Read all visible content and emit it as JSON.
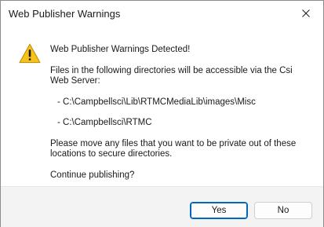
{
  "window": {
    "title": "Web Publisher Warnings",
    "close_icon": "close-icon"
  },
  "dialog": {
    "icon": "warning-triangle-icon",
    "heading": "Web Publisher Warnings Detected!",
    "files_line1": "Files in the following directories will be accessible via the Csi",
    "files_line2": "Web Server:",
    "directories": [
      "- C:\\Campbellsci\\Lib\\RTMCMediaLib\\images\\Misc",
      "- C:\\Campbellsci\\RTMC"
    ],
    "move_line1": "Please move any files that you want to be private out of these",
    "move_line2": "locations to secure directories.",
    "question": "Continue publishing?"
  },
  "buttons": {
    "yes_label": "Yes",
    "no_label": "No"
  }
}
